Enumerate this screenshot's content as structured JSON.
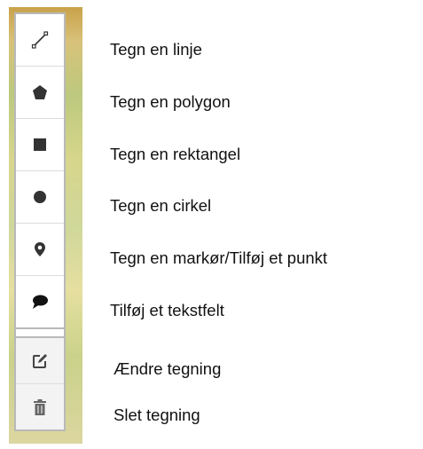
{
  "tools": [
    {
      "icon": "polyline-icon",
      "label": "Tegn en linje"
    },
    {
      "icon": "polygon-icon",
      "label": "Tegn en polygon"
    },
    {
      "icon": "rectangle-icon",
      "label": "Tegn en rektangel"
    },
    {
      "icon": "circle-icon",
      "label": "Tegn en cirkel"
    },
    {
      "icon": "marker-icon",
      "label": "Tegn en markør/Tilføj et punkt"
    },
    {
      "icon": "speech-bubble-icon",
      "label": "Tilføj et tekstfelt"
    }
  ],
  "edit_tools": [
    {
      "icon": "edit-icon",
      "label": "Ændre tegning"
    },
    {
      "icon": "trash-icon",
      "label": "Slet tegning"
    }
  ]
}
